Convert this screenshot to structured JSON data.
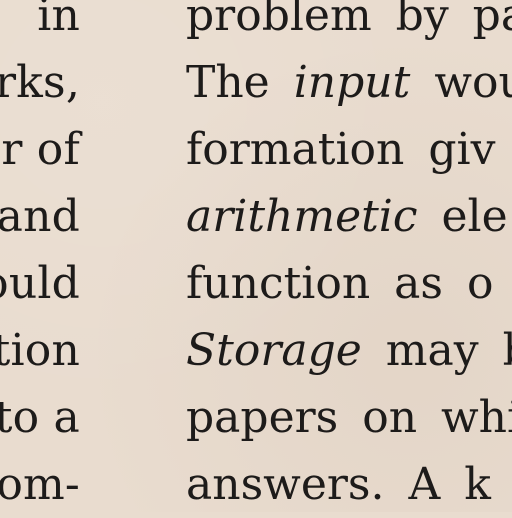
{
  "document": {
    "left_column_lines": [
      "in",
      "rks,",
      "r of",
      "and",
      "ould",
      "tion",
      "to a",
      "om-"
    ],
    "right_column_lines": [
      {
        "prefix": "",
        "italic": "",
        "suffix": "problem by pa"
      },
      {
        "prefix": "The ",
        "italic": "input",
        "suffix": " wou"
      },
      {
        "prefix": "",
        "italic": "",
        "suffix": "formation giv"
      },
      {
        "prefix": "",
        "italic": "arithmetic",
        "suffix": " ele"
      },
      {
        "prefix": "",
        "italic": "",
        "suffix": "function as o"
      },
      {
        "prefix": "",
        "italic": "Storage",
        "suffix": " may b"
      },
      {
        "prefix": "",
        "italic": "",
        "suffix": "papers on whi"
      },
      {
        "prefix": "",
        "italic": "",
        "suffix": "answers. A k"
      }
    ]
  }
}
